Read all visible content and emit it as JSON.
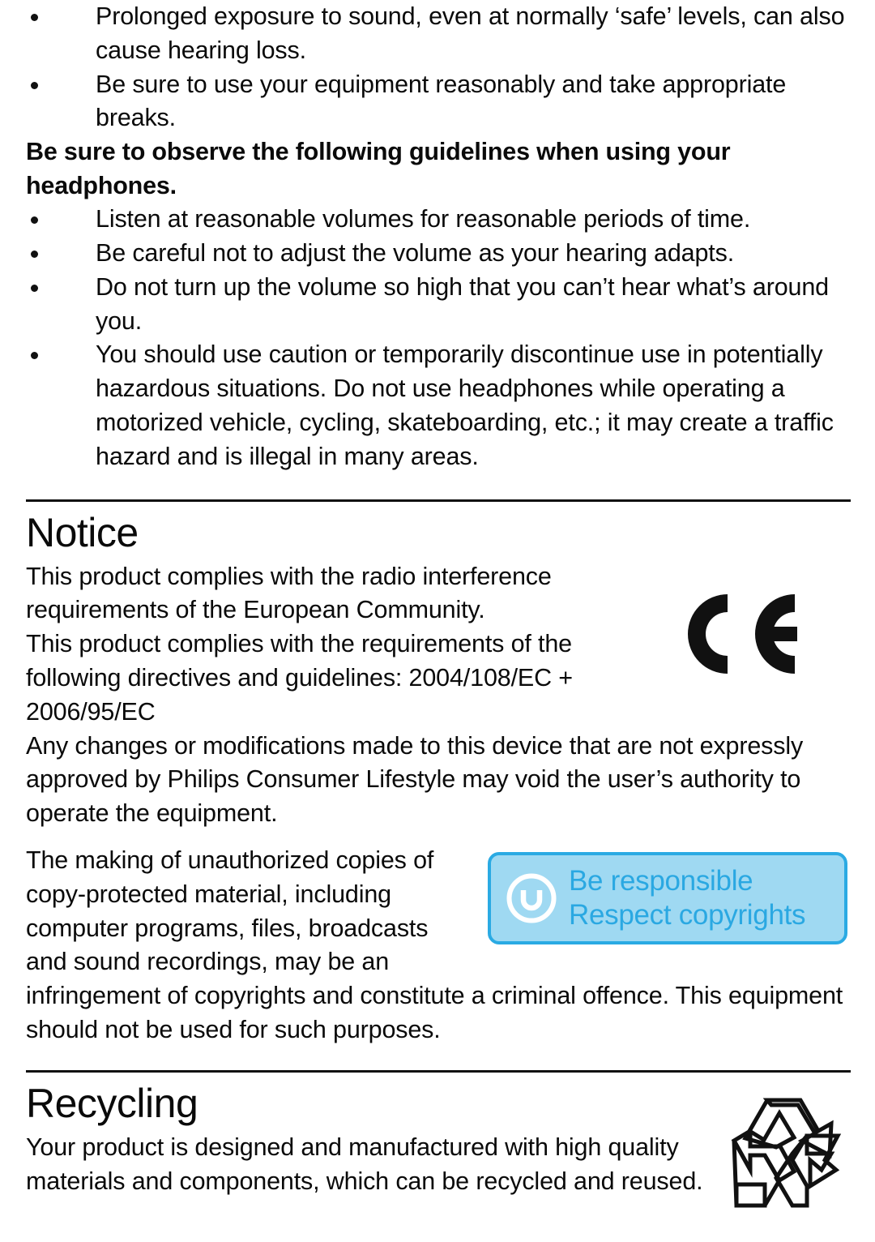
{
  "safety": {
    "intro_bullets": [
      "Prolonged exposure to sound, even at normally ‘safe’ levels, can also cause hearing loss.",
      "Be sure to use your equipment reasonably and take appropriate breaks."
    ],
    "heading": "Be sure to observe the following guidelines when using your headphones.",
    "guideline_bullets": [
      "Listen at reasonable volumes for reasonable periods of time.",
      "Be careful not to adjust the volume as your hearing adapts.",
      "Do not turn up the volume so high that you can’t hear what’s around you.",
      "You should use caution or temporarily discontinue use in potentially hazardous situations. Do not use headphones while operating a motorized vehicle, cycling, skateboarding, etc.; it may create a traffic hazard and is illegal in many areas."
    ]
  },
  "notice": {
    "title": "Notice",
    "paragraph_1": "This product complies with the radio interference requirements of the European Community.",
    "paragraph_2": "This product complies with the requirements of the following directives and guidelines: 2004/108/EC + 2006/95/EC",
    "paragraph_3": "Any changes or modifications made to this device that are not expressly approved by Philips Consumer Lifestyle may void the user’s authority to operate the equipment.",
    "copyright_paragraph": "The making of unauthorized copies of copy-protected material, including computer programs, files, broadcasts and sound recordings, may be an infringement of copyrights and constitute a criminal offence. This equipment should not be used for such purposes.",
    "ce_mark_label": "CE",
    "badge": {
      "line_1": "Be responsible",
      "line_2": "Respect copyrights",
      "icon": "copyright-circle-icon",
      "fill_color": "#9fd9f2",
      "border_color": "#2aaae3",
      "text_color": "#2aa8e2"
    }
  },
  "recycling": {
    "title": "Recycling",
    "paragraph": "Your product is designed and manufactured with high quality materials and components, which can be recycled and reused.",
    "icon": "recycling-mobius-icon"
  }
}
